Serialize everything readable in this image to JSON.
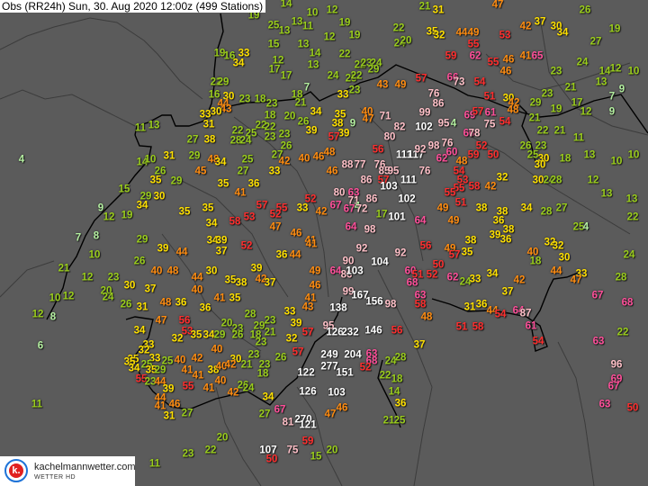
{
  "title": "Obs (RR24h) Sun, 30. Aug 2020 12:00z (499 Stations)",
  "logo": {
    "name": "kachelmannwetter.com",
    "sub": "WETTER HD",
    "mark": "k."
  },
  "colors": {
    "background": "#5b5b5b",
    "lt10": "#b4f0a0",
    "10to29": "#9acd1c",
    "30to39": "#ffe000",
    "40to49": "#ff8c10",
    "50to59": "#ff2e2e",
    "60to69": "#ff4f9a",
    "70to99": "#ffc0c8",
    "100plus": "#ffffff"
  },
  "stations": [
    14,
    19,
    10,
    25,
    13,
    13,
    11,
    15,
    13,
    14,
    12,
    17,
    17,
    13,
    19,
    16,
    33,
    34,
    22,
    29,
    16,
    30,
    23,
    18,
    23,
    18,
    7,
    21,
    20,
    26,
    34,
    39,
    18,
    22,
    22,
    23,
    23,
    26,
    27,
    42,
    40,
    46,
    33,
    44,
    43,
    30,
    33,
    31,
    11,
    13,
    22,
    25,
    28,
    24,
    27,
    38,
    31,
    29,
    48,
    34,
    25,
    27,
    45,
    4,
    14,
    10,
    26,
    35,
    29,
    15,
    29,
    30,
    34,
    9,
    12,
    19,
    35,
    35,
    36,
    35,
    41,
    57,
    55,
    52,
    33,
    42,
    52,
    53,
    58,
    34,
    47,
    46,
    7,
    8,
    29,
    34,
    39,
    41,
    12,
    19,
    12,
    19,
    22,
    24,
    20,
    21,
    31,
    47,
    35,
    32,
    44,
    49,
    55,
    53,
    42,
    37,
    30,
    34,
    26,
    19,
    27,
    22,
    22,
    23,
    24,
    29,
    24,
    25,
    22,
    23,
    33,
    43,
    49,
    57,
    59,
    62,
    66,
    73,
    54,
    55,
    46,
    46,
    41,
    65,
    24,
    23,
    14,
    12,
    10,
    13,
    21,
    23,
    9,
    7,
    30,
    42,
    48,
    51,
    76,
    86,
    99,
    69,
    57,
    61,
    29,
    19,
    17,
    12,
    9,
    21,
    75,
    54,
    35,
    38,
    9,
    39,
    40,
    47,
    71,
    82,
    102,
    95,
    4,
    80,
    60,
    78,
    22,
    21,
    11,
    57,
    56,
    111,
    117,
    92,
    98,
    76,
    62,
    60,
    52,
    59,
    50,
    48,
    26,
    23,
    25,
    30,
    30,
    18,
    13,
    10,
    10,
    48,
    46,
    88,
    77,
    76,
    85,
    95,
    76,
    54,
    86,
    57,
    111,
    53,
    55,
    58,
    42,
    32,
    30,
    24,
    28,
    12,
    13,
    13,
    80,
    63,
    71,
    103,
    86,
    102,
    55,
    51,
    49,
    38,
    38,
    34,
    28,
    27,
    22,
    67,
    67,
    4,
    72,
    17,
    101,
    64,
    49,
    36,
    38,
    25,
    4,
    64,
    98,
    38,
    39,
    36,
    32,
    10,
    26,
    39,
    44,
    37,
    52,
    36,
    44,
    41,
    21,
    12,
    23,
    40,
    48,
    30,
    44,
    39,
    35,
    38,
    42,
    37,
    49,
    30,
    37,
    40,
    46,
    10,
    12,
    20,
    24,
    26,
    31,
    48,
    36,
    36,
    41,
    35,
    41,
    43,
    28,
    33,
    12,
    8,
    47,
    56,
    20,
    23,
    29,
    23,
    39,
    57,
    34,
    53,
    32,
    35,
    34,
    29,
    26,
    18,
    21,
    23,
    32,
    6,
    33,
    32,
    40,
    57,
    23,
    26,
    35,
    33,
    25,
    35,
    25,
    40,
    42,
    30,
    21,
    23,
    34,
    35,
    29,
    41,
    41,
    38,
    40,
    42,
    122,
    18,
    55,
    23,
    44,
    55,
    39,
    40,
    41,
    26,
    24,
    42,
    126,
    11,
    44,
    41,
    46,
    34,
    31,
    27,
    27,
    67,
    81,
    270,
    121,
    20,
    22,
    59,
    107,
    75,
    23,
    50,
    15,
    11,
    92,
    92,
    56,
    49,
    57,
    35,
    40,
    18,
    32,
    30,
    24,
    90,
    64,
    86,
    103,
    104,
    50,
    60,
    51,
    52,
    62,
    24,
    33,
    34,
    42,
    44,
    33,
    47,
    28,
    68,
    99,
    167,
    156,
    98,
    63,
    58,
    37,
    67,
    68,
    138,
    31,
    36,
    44,
    54,
    64,
    87,
    48,
    95,
    126,
    232,
    146,
    56,
    51,
    58,
    61,
    22,
    37,
    54,
    63,
    249,
    204,
    63,
    68,
    24,
    28,
    277,
    151,
    52,
    22,
    18,
    96,
    69,
    67,
    103,
    14,
    36,
    63,
    47,
    46,
    21,
    25,
    50,
    20
  ]
}
